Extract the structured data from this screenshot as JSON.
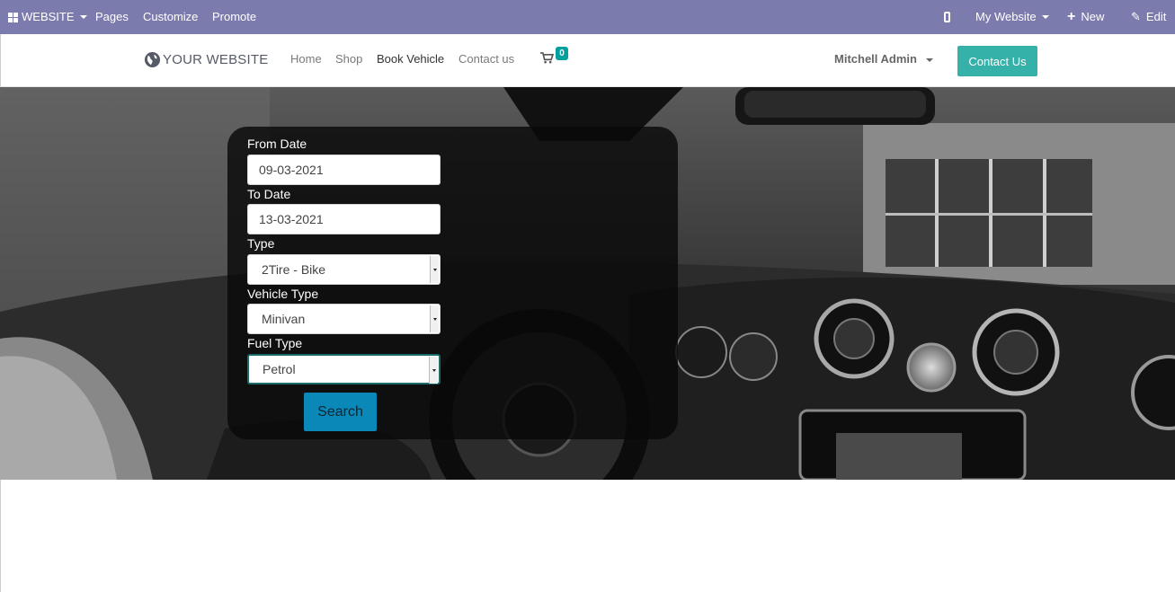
{
  "admin_bar": {
    "apps_label": "WEBSITE",
    "pages_label": "Pages",
    "customize_label": "Customize",
    "promote_label": "Promote",
    "mobile_icon": "mobile-phone-icon",
    "my_website_label": "My Website",
    "new_label": "New",
    "edit_label": "Edit",
    "background_color": "#7c7bad"
  },
  "header": {
    "logo_text": "YOUR WEBSITE",
    "nav": [
      {
        "label": "Home"
      },
      {
        "label": "Shop"
      },
      {
        "label": "Book Vehicle"
      },
      {
        "label": "Contact us"
      }
    ],
    "active_nav": "Book Vehicle",
    "cart_count": "0",
    "user_name": "Mitchell Admin",
    "contact_button_label": "Contact Us",
    "accent_color": "#35b1a9"
  },
  "booking_form": {
    "from_date_label": "From Date",
    "from_date_value": "09-03-2021",
    "to_date_label": "To Date",
    "to_date_value": "13-03-2021",
    "type_label": "Type",
    "type_value": "2Tire - Bike",
    "vehicle_type_label": "Vehicle Type",
    "vehicle_type_value": "Minivan",
    "fuel_type_label": "Fuel Type",
    "fuel_type_value": "Petrol",
    "search_button_label": "Search"
  }
}
